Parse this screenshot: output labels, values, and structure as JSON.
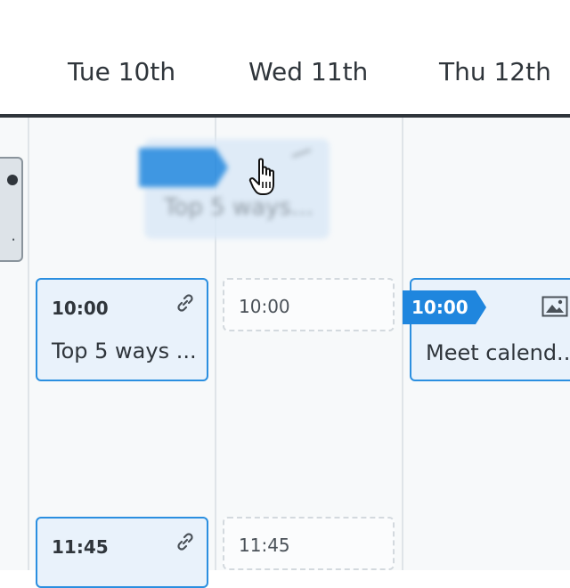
{
  "header": {
    "days": [
      "Tue 10th",
      "Wed 11th",
      "Thu 12th"
    ]
  },
  "left_partial": {
    "text": "."
  },
  "ghost": {
    "badge_label": "",
    "title": "Top 5 ways..."
  },
  "columns": {
    "tue": {
      "events": [
        {
          "time": "10:00",
          "title": "Top 5 ways ..."
        },
        {
          "time": "11:45",
          "title": ""
        }
      ]
    },
    "wed": {
      "slots": [
        {
          "time": "10:00"
        },
        {
          "time": "11:45"
        }
      ]
    },
    "thu": {
      "events": [
        {
          "time": "10:00",
          "title": "Meet calend..."
        }
      ]
    }
  },
  "colors": {
    "accent": "#1f86de",
    "card_bg": "#e9f2fb",
    "card_border": "#2b8fe0",
    "text": "#2f353b"
  },
  "icons": [
    "link-icon",
    "image-icon",
    "hand-cursor-icon"
  ]
}
